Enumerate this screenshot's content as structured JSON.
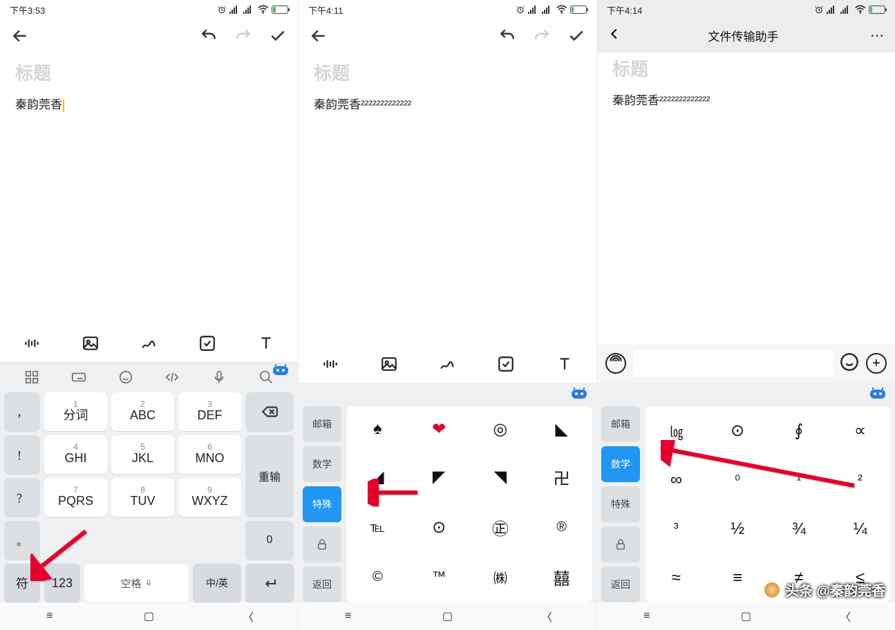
{
  "status_icons_note": "alarm, HD sim1, HD sim2, wifi, battery",
  "screen1": {
    "time": "下午3:53",
    "battery": "11",
    "title_placeholder": "标题",
    "body": "秦韵莞香",
    "kb": {
      "top_icons": [
        "grid",
        "keyboard",
        "emoji",
        "tags",
        "mic",
        "search"
      ],
      "side_left": [
        "，",
        "！",
        "？",
        "。"
      ],
      "keys": [
        {
          "n": "1",
          "l": "分词"
        },
        {
          "n": "2",
          "l": "ABC"
        },
        {
          "n": "3",
          "l": "DEF"
        },
        {
          "n": "4",
          "l": "GHI"
        },
        {
          "n": "5",
          "l": "JKL"
        },
        {
          "n": "6",
          "l": "MNO"
        },
        {
          "n": "7",
          "l": "PQRS"
        },
        {
          "n": "8",
          "l": "TUV"
        },
        {
          "n": "9",
          "l": "WXYZ"
        }
      ],
      "side_right_del": "⌫",
      "side_right_retype": "重输",
      "side_right_zero": "0",
      "bottom": {
        "sym": "符",
        "num": "123",
        "space": "空格",
        "lang": "中/英",
        "enter": "↵"
      }
    }
  },
  "screen2": {
    "time": "下午4:11",
    "battery": "8",
    "title_placeholder": "标题",
    "body": "秦韵莞香²²²²²²²²²²²²²",
    "cats": [
      "邮箱",
      "数学",
      "特殊",
      "🔒",
      "返回"
    ],
    "active_cat_index": 2,
    "symbols": [
      "♠",
      "❤",
      "◎",
      "◣",
      "◢",
      "◤",
      "◥",
      "卍",
      "℡",
      "⊙",
      "㊣",
      "®",
      "©",
      "™",
      "㈱",
      "囍"
    ]
  },
  "screen3": {
    "time": "下午4:14",
    "battery": "8",
    "chat_title": "文件传输助手",
    "title_placeholder": "标题",
    "body": "秦韵莞香²²²²²²²²²²²²²",
    "cats": [
      "邮箱",
      "数学",
      "特殊",
      "🔒",
      "返回"
    ],
    "active_cat_index": 1,
    "symbols": [
      "㏒",
      "⊙",
      "∮",
      "∝",
      "∞",
      "⁰",
      "¹",
      "²",
      "³",
      "½",
      "¾",
      "¼",
      "≈",
      "≡",
      "≠",
      "≤"
    ]
  },
  "watermark": "头条 @秦韵莞香"
}
